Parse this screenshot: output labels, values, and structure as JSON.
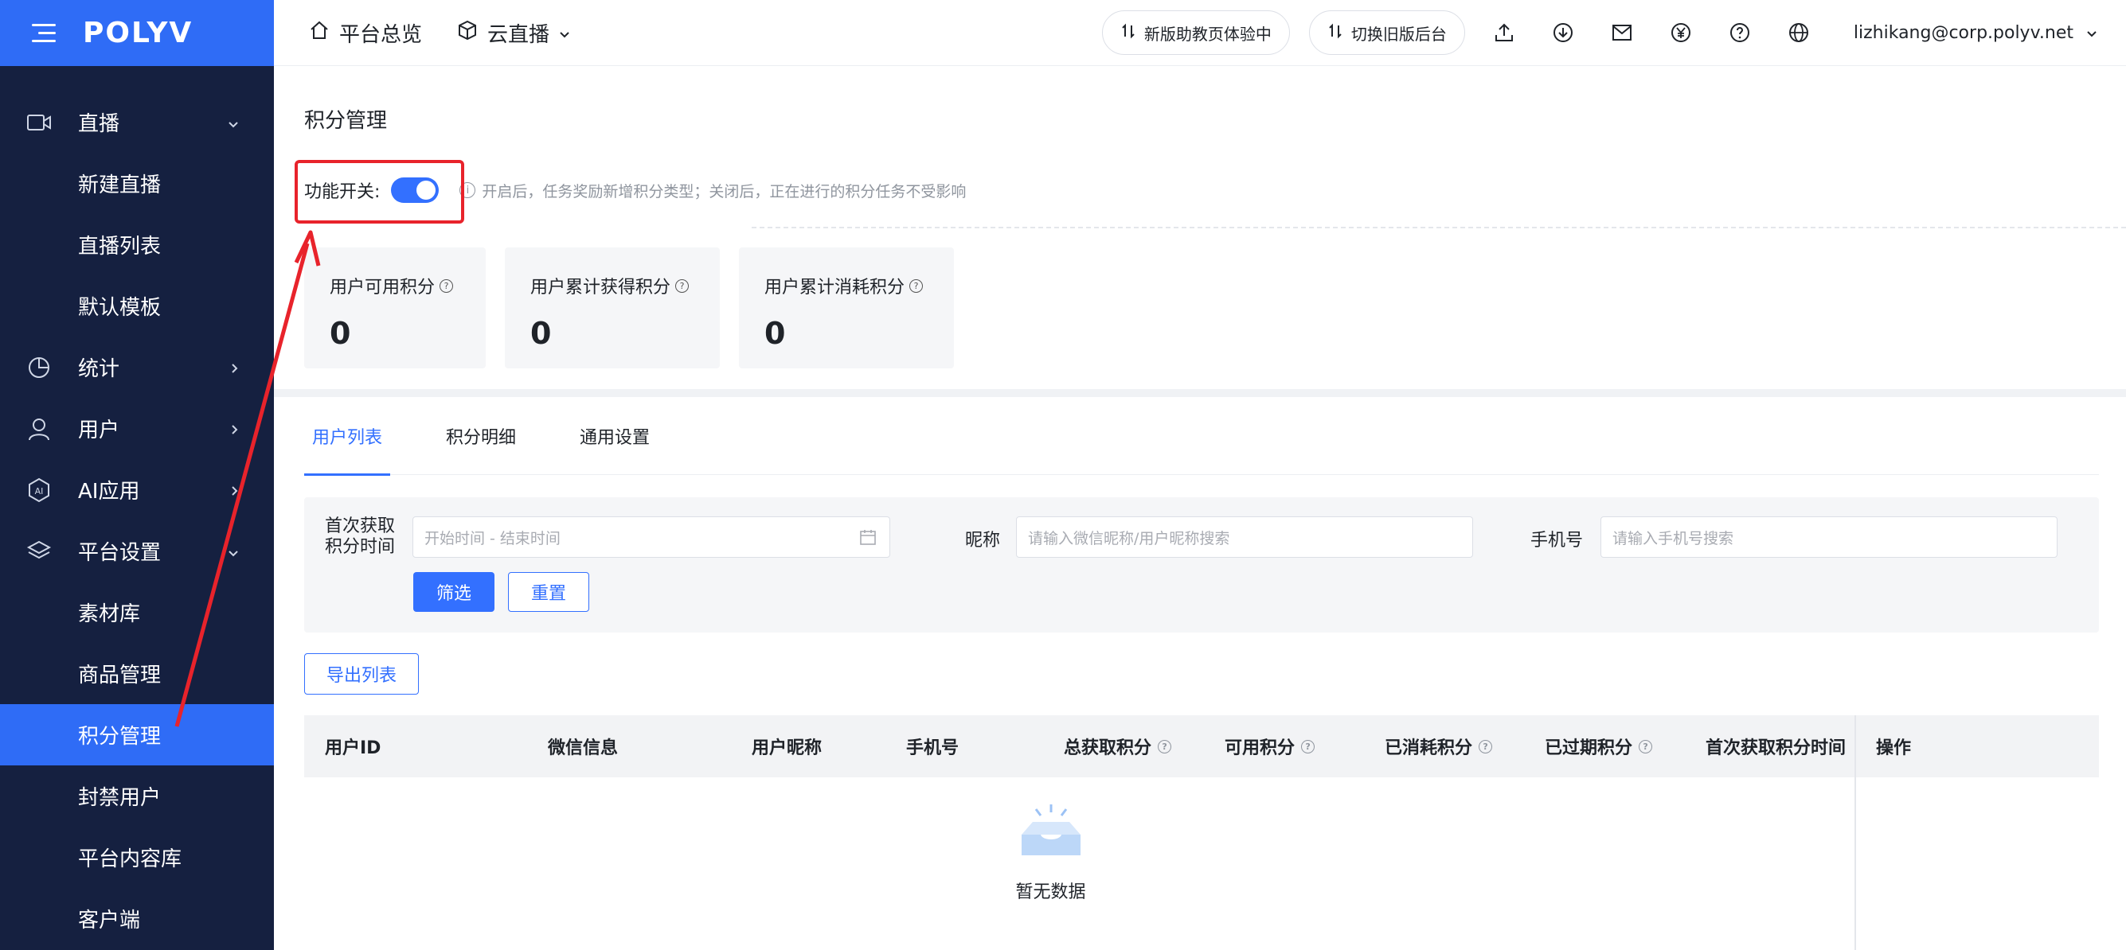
{
  "brand": {
    "logo": "POLYV"
  },
  "sidebar": {
    "items": [
      {
        "label": "直播",
        "type": "parent",
        "icon": "video-camera-icon",
        "chevron": "down"
      },
      {
        "label": "新建直播",
        "type": "child"
      },
      {
        "label": "直播列表",
        "type": "child"
      },
      {
        "label": "默认模板",
        "type": "child"
      },
      {
        "label": "统计",
        "type": "parent",
        "icon": "pie-chart-icon",
        "chevron": "right"
      },
      {
        "label": "用户",
        "type": "parent",
        "icon": "user-icon",
        "chevron": "right"
      },
      {
        "label": "AI应用",
        "type": "parent",
        "icon": "ai-icon",
        "chevron": "right"
      },
      {
        "label": "平台设置",
        "type": "parent",
        "icon": "layers-icon",
        "chevron": "down"
      },
      {
        "label": "素材库",
        "type": "child"
      },
      {
        "label": "商品管理",
        "type": "child"
      },
      {
        "label": "积分管理",
        "type": "child",
        "active": true
      },
      {
        "label": "封禁用户",
        "type": "child"
      },
      {
        "label": "平台内容库",
        "type": "child"
      },
      {
        "label": "客户端",
        "type": "child"
      }
    ]
  },
  "header": {
    "overview": "平台总览",
    "product": "云直播",
    "assistant_btn": "新版助教页体验中",
    "switch_btn": "切换旧版后台",
    "user_email": "lizhikang@corp.polyv.net"
  },
  "page": {
    "title": "积分管理",
    "switch_label": "功能开关:",
    "switch_on": true,
    "hint": "开启后，任务奖励新增积分类型；关闭后，正在进行的积分任务不受影响",
    "hint_icon": "info-icon"
  },
  "stats": [
    {
      "label": "用户可用积分",
      "value": "0"
    },
    {
      "label": "用户累计获得积分",
      "value": "0"
    },
    {
      "label": "用户累计消耗积分",
      "value": "0"
    }
  ],
  "tabs": [
    "用户列表",
    "积分明细",
    "通用设置"
  ],
  "filters": {
    "time_label_1": "首次获取",
    "time_label_2": "积分时间",
    "time_placeholder": "开始时间 - 结束时间",
    "nickname_label": "昵称",
    "nickname_placeholder": "请输入微信昵称/用户昵称搜索",
    "phone_label": "手机号",
    "phone_placeholder": "请输入手机号搜索",
    "filter_btn": "筛选",
    "reset_btn": "重置"
  },
  "export_btn": "导出列表",
  "table": {
    "columns": [
      "用户ID",
      "微信信息",
      "用户昵称",
      "手机号",
      "总获取积分",
      "可用积分",
      "已消耗积分",
      "已过期积分",
      "首次获取积分时间",
      "操作"
    ],
    "empty_text": "暂无数据"
  },
  "colors": {
    "brand": "#2f6cf6",
    "sidebar_bg": "#152040",
    "accent": "#3370ff",
    "highlight": "#e8232b"
  }
}
